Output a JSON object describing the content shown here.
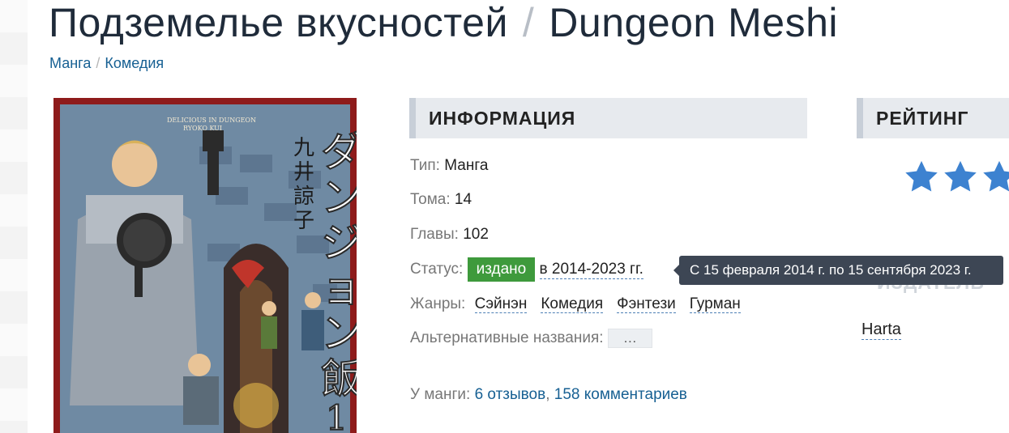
{
  "title": {
    "russian": "Подземелье вкусностей",
    "separator": "/",
    "original": "Dungeon Meshi"
  },
  "breadcrumbs": [
    {
      "label": "Манга"
    },
    {
      "label": "Комедия"
    }
  ],
  "breadcrumb_separator": "/",
  "cover": {
    "subtitle_text": "DELICIOUS IN DUNGEON",
    "author_latin": "RYOKO KUI",
    "title_jp": "ダンジョン飯",
    "author_jp": "九井諒子",
    "volume": "1"
  },
  "info": {
    "heading": "ИНФОРМАЦИЯ",
    "type_label": "Тип:",
    "type_value": "Манга",
    "volumes_label": "Тома:",
    "volumes_value": "14",
    "chapters_label": "Главы:",
    "chapters_value": "102",
    "status_label": "Статус:",
    "status_value": "издано",
    "status_years": "в 2014-2023 гг.",
    "genres_label": "Жанры:",
    "genres": [
      "Сэйнэн",
      "Комедия",
      "Фэнтези",
      "Гурман"
    ],
    "alt_names_label": "Альтернативные названия:",
    "alt_names_button": "…",
    "reviews_prefix": "У манги:",
    "reviews_link": "6 отзывов",
    "comma": ",",
    "comments_link": "158 комментариев"
  },
  "tooltip": {
    "text": "С 15 февраля 2014 г. по 15 сентября 2023 г."
  },
  "rating": {
    "heading": "РЕЙТИНГ",
    "stars_visible": 3,
    "star_color": "#3d82d0"
  },
  "publisher": {
    "heading": "ИЗДАТЕЛЬ",
    "name": "Harta"
  },
  "colors": {
    "link": "#176093",
    "status_badge": "#3e9a3c",
    "tooltip_bg": "#3d4654",
    "heading_bg": "#e7eaee"
  }
}
